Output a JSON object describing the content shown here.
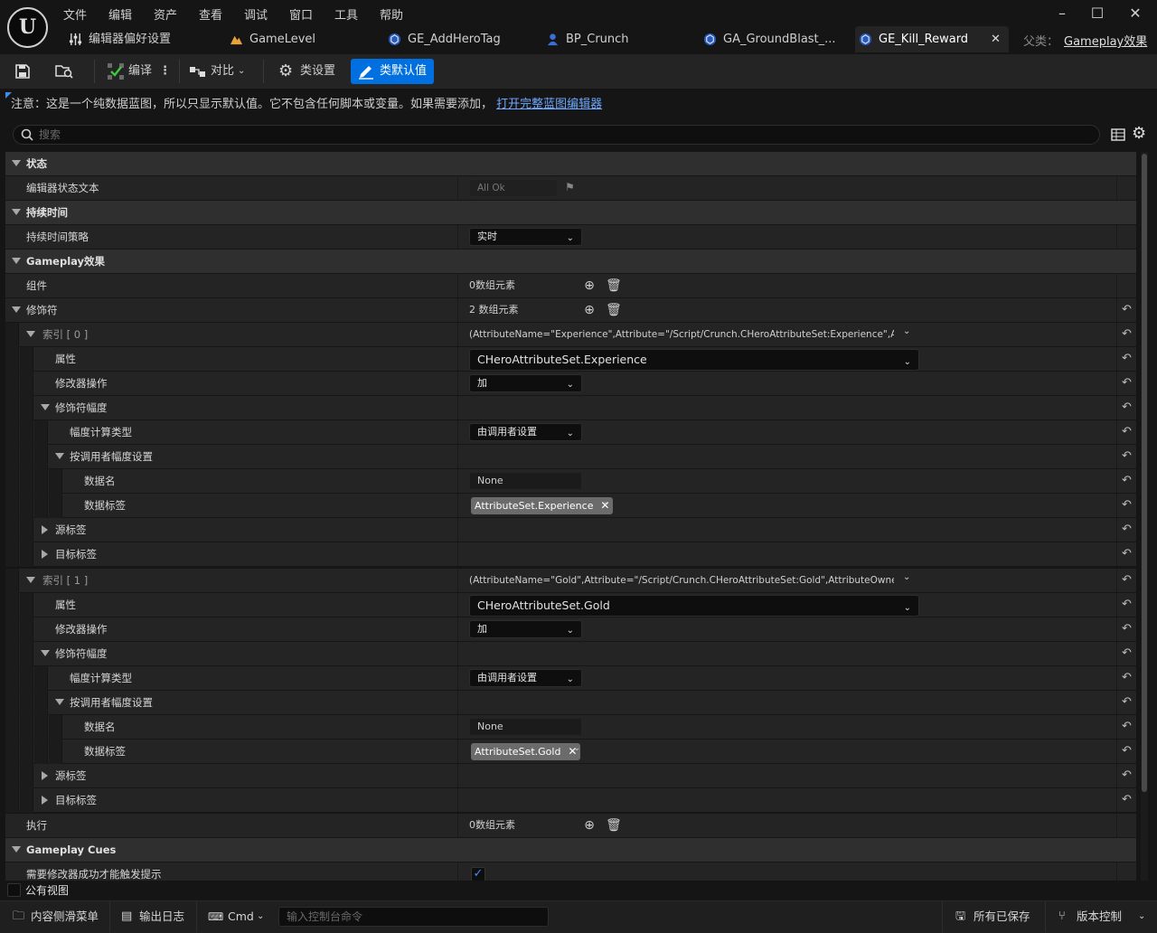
{
  "menu": [
    "文件",
    "编辑",
    "资产",
    "查看",
    "调试",
    "窗口",
    "工具",
    "帮助"
  ],
  "tabs": [
    {
      "label": "编辑器偏好设置",
      "icon": "sliders-icon"
    },
    {
      "label": "GameLevel",
      "icon": "level-icon"
    },
    {
      "label": "GE_AddHeroTag",
      "icon": "blueprint-icon"
    },
    {
      "label": "BP_Crunch",
      "icon": "character-icon"
    },
    {
      "label": "GA_GroundBlast_...",
      "icon": "blueprint-icon"
    },
    {
      "label": "GE_Kill_Reward",
      "icon": "blueprint-icon",
      "active": true
    }
  ],
  "parent_class": {
    "label": "父类：",
    "value": "Gameplay效果"
  },
  "toolbar": {
    "compile": "编译",
    "diff": "对比",
    "class_settings": "类设置",
    "class_defaults": "类默认值"
  },
  "notice": {
    "text": "注意：这是一个纯数据蓝图，所以只显示默认值。它不包含任何脚本或变量。如果需要添加，",
    "link": "打开完整蓝图编辑器"
  },
  "search": {
    "placeholder": "搜索"
  },
  "details": {
    "cat_status": "状态",
    "editor_status_text": "编辑器状态文本",
    "editor_status_value": "All Ok",
    "cat_duration": "持续时间",
    "duration_policy": "持续时间策略",
    "duration_policy_value": "实时",
    "cat_gameplay_effect": "Gameplay效果",
    "components": "组件",
    "components_value": "0数组元素",
    "modifiers": "修饰符",
    "modifiers_value": "2 数组元素",
    "index0": "索引 [ 0 ]",
    "index0_value": "(AttributeName=\"Experience\",Attribute=\"/Script/Crunch.CHeroAttributeSet:Experience\",Attri",
    "attribute": "属性",
    "attribute0_value": "CHeroAttributeSet.Experience",
    "modifier_op": "修改器操作",
    "modifier_op_value": "加",
    "modifier_magnitude": "修饰符幅度",
    "magnitude_calc_type": "幅度计算类型",
    "magnitude_calc_value": "由调用者设置",
    "set_by_caller": "按调用者幅度设置",
    "data_name": "数据名",
    "data_name_value": "None",
    "data_tag": "数据标签",
    "data_tag0_value": "AttributeSet.Experience",
    "source_tags": "源标签",
    "target_tags": "目标标签",
    "index1": "索引 [ 1 ]",
    "index1_value": "(AttributeName=\"Gold\",Attribute=\"/Script/Crunch.CHeroAttributeSet:Gold\",AttributeOwner=\",",
    "attribute1_value": "CHeroAttributeSet.Gold",
    "data_tag1_value": "AttributeSet.Gold",
    "executions": "执行",
    "executions_value": "0数组元素",
    "cat_cues": "Gameplay Cues",
    "require_modifier_success": "需要修改器成功才能触发提示",
    "require_modifier_success_checked": true
  },
  "public_view": "公有视图",
  "statusbar": {
    "content_drawer": "内容侧滑菜单",
    "output_log": "输出日志",
    "cmd": "Cmd",
    "cmd_placeholder": "输入控制台命令",
    "all_saved": "所有已保存",
    "source_control": "版本控制"
  },
  "colors": {
    "accent": "#0070e0",
    "link": "#6ea8ff",
    "panel": "#242424",
    "category": "#2f2f2f"
  }
}
